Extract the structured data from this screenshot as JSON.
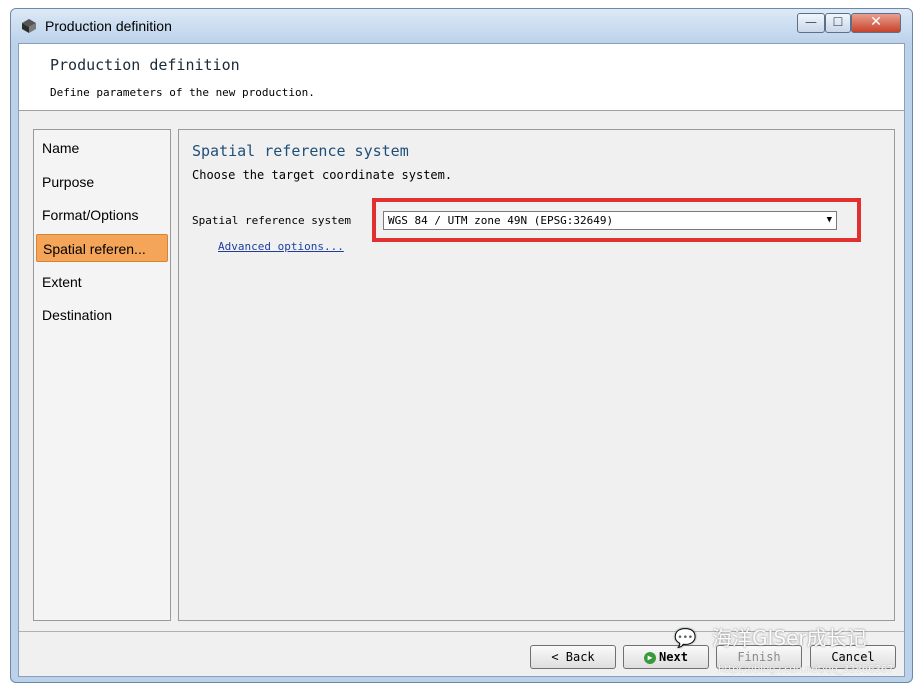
{
  "window": {
    "title": "Production definition",
    "controls": {
      "minimize": "—",
      "maximize": "☐",
      "close": "✕"
    }
  },
  "header": {
    "title": "Production definition",
    "subtitle": "Define parameters of the new production."
  },
  "nav": {
    "items": [
      {
        "label": "Name",
        "active": false
      },
      {
        "label": "Purpose",
        "active": false
      },
      {
        "label": "Format/Options",
        "active": false
      },
      {
        "label": "Spatial referen...",
        "active": true
      },
      {
        "label": "Extent",
        "active": false
      },
      {
        "label": "Destination",
        "active": false
      }
    ]
  },
  "panel": {
    "title": "Spatial reference system",
    "subtitle": "Choose the target coordinate system.",
    "field_label": "Spatial reference system",
    "select_value": "WGS 84 / UTM zone 49N (EPSG:32649)",
    "advanced_link": "Advanced options...",
    "highlight_color": "#e03030"
  },
  "footer": {
    "back": "< Back",
    "next": "Next",
    "finish": "Finish",
    "cancel": "Cancel"
  },
  "watermark": {
    "text": "海洋GISer成长记",
    "url": "https://blog.csdn.net/qq_32866367"
  }
}
